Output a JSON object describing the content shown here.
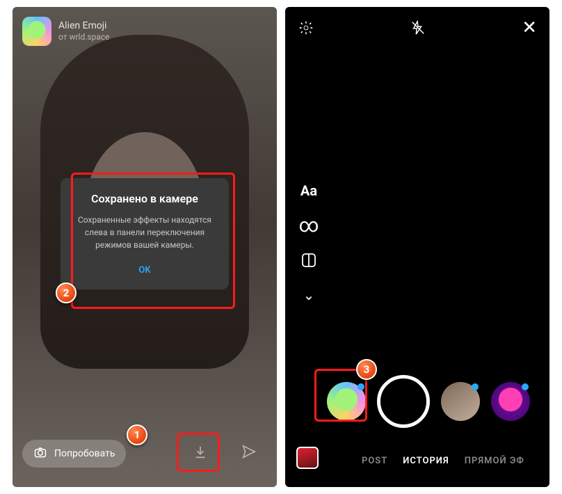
{
  "left": {
    "effect_name": "Alien Emoji",
    "effect_author": "от wrld.space",
    "dialog": {
      "title": "Сохранено в камере",
      "message": "Сохраненные эффекты находятся слева в панели переключения режимов вашей камеры.",
      "ok": "OK"
    },
    "try_label": "Попробовать"
  },
  "right": {
    "rail": {
      "text_mode": "Aa",
      "boomerang": "∞",
      "chevron": "⌄"
    },
    "modes": {
      "post": "POST",
      "story": "ИСТОРИЯ",
      "live": "ПРЯМОЙ ЭФ"
    },
    "effects": [
      {
        "name": "alien-emoji",
        "new": true
      },
      {
        "name": "shutter"
      },
      {
        "name": "filter-warm",
        "new": true
      },
      {
        "name": "alien-purple",
        "new": true
      }
    ]
  },
  "annotations": {
    "b1": "1",
    "b2": "2",
    "b3": "3"
  }
}
